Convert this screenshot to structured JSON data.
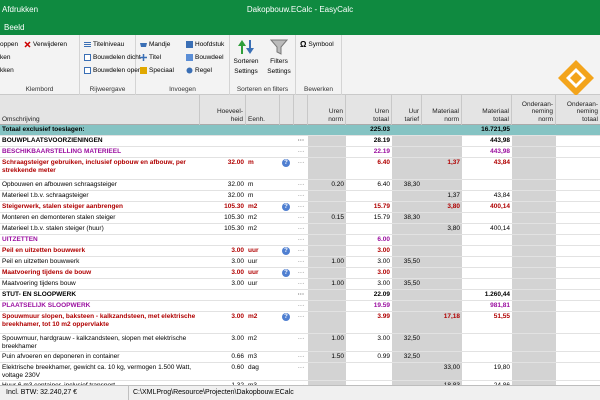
{
  "titlebar": {
    "left_menu": "Afdrukken",
    "title": "Dakopbouw.ECalc  -  EasyCalc"
  },
  "menubar": {
    "item": "Beeld"
  },
  "ribbon": {
    "klembord": {
      "label": "Klembord",
      "buttons": [
        "oppen",
        "Verwijderen",
        "ken",
        "kken"
      ]
    },
    "rijweergave": {
      "label": "Rijweergave",
      "buttons": [
        "Titelniveau",
        "Bouwdelen dicht",
        "Bouwdelen open"
      ]
    },
    "invoegen": {
      "label": "Invoegen",
      "buttons": [
        "Mandje",
        "Hoofdstuk",
        "Titel",
        "Bouwdeel",
        "Speciaal",
        "Regel"
      ]
    },
    "sorteren": {
      "label": "Sorteren en filters",
      "sort_label": "Sorteren",
      "sort_label2": "Settings",
      "filter_label": "Filters",
      "filter_label2": "Settings"
    },
    "bewerken": {
      "label": "Bewerken",
      "symbool": "Symbool"
    }
  },
  "columns": {
    "desc": "Omschrijving",
    "qty": "Hoeveel-\nheid",
    "unit": "Eenh.",
    "uren_norm": "Uren\nnorm",
    "uren_totaal": "Uren\ntotaal",
    "uur_tarief": "Uur\ntarief",
    "mat_norm": "Materiaal\nnorm",
    "mat_totaal": "Materiaal\ntotaal",
    "ond_norm": "Onderaan-\nneming\nnorm",
    "ond_totaal": "Onderaan-\nneming\ntotaal"
  },
  "rows": [
    {
      "type": "total",
      "desc": "Totaal exclusief toeslagen:",
      "ut": "225.03",
      "mt": "16.721,95"
    },
    {
      "type": "section",
      "desc": "BOUWPLAATSVOORZIENINGEN",
      "ut": "28.19",
      "mt": "443,98"
    },
    {
      "type": "sub",
      "desc": "BESCHIKBAARSTELLING MATERIEEL",
      "ut": "22.19",
      "mt": "443,98"
    },
    {
      "type": "item",
      "h": 22,
      "desc": "Schraagsteiger gebruiken, inclusief opbouw en afbouw, per strekkende meter",
      "qty": "32.00",
      "unit": "m",
      "info": true,
      "ut": "6.40",
      "mn": "1,37",
      "mt": "43,84"
    },
    {
      "type": "plain",
      "desc": "Opbouwen en afbouwen schraagsteiger",
      "qty": "32.00",
      "unit": "m",
      "un": "0.20",
      "ut": "6.40",
      "ur": "38,30"
    },
    {
      "type": "plain",
      "desc": "Materieel t.b.v. schraagsteiger",
      "qty": "32.00",
      "unit": "m",
      "mn": "1,37",
      "mt": "43,84"
    },
    {
      "type": "item",
      "desc": "Steigerwerk, stalen steiger aanbrengen",
      "qty": "105.30",
      "unit": "m2",
      "info": true,
      "ut": "15.79",
      "mn": "3,80",
      "mt": "400,14"
    },
    {
      "type": "plain",
      "desc": "Monteren en demonteren stalen steiger",
      "qty": "105.30",
      "unit": "m2",
      "un": "0.15",
      "ut": "15.79",
      "ur": "38,30"
    },
    {
      "type": "plain",
      "desc": "Materieel t.b.v. stalen steiger (huur)",
      "qty": "105.30",
      "unit": "m2",
      "mn": "3,80",
      "mt": "400,14"
    },
    {
      "type": "sub",
      "desc": "UITZETTEN",
      "ut": "6.00"
    },
    {
      "type": "item",
      "desc": "Peil en uitzetten bouwwerk",
      "qty": "3.00",
      "unit": "uur",
      "info": true,
      "ut": "3.00"
    },
    {
      "type": "plain",
      "desc": "Peil en uitzetten bouwwerk",
      "qty": "3.00",
      "unit": "uur",
      "un": "1.00",
      "ut": "3.00",
      "ur": "35,50"
    },
    {
      "type": "item",
      "desc": "Maatvoering tijdens de bouw",
      "qty": "3.00",
      "unit": "uur",
      "info": true,
      "ut": "3.00"
    },
    {
      "type": "plain",
      "desc": "Maatvoering tijdens bouw",
      "qty": "3.00",
      "unit": "uur",
      "un": "1.00",
      "ut": "3.00",
      "ur": "35,50"
    },
    {
      "type": "section",
      "desc": "STUT- EN SLOOPWERK",
      "ut": "22.09",
      "mt": "1.260,44"
    },
    {
      "type": "sub",
      "desc": "PLAATSELIJK SLOOPWERK",
      "ut": "19.59",
      "mt": "981,81"
    },
    {
      "type": "item",
      "h": 22,
      "desc": "Spouwmuur slopen, baksteen - kalkzandsteen, met elektrische breekhamer, tot 10 m2 oppervlakte",
      "qty": "3.00",
      "unit": "m2",
      "info": true,
      "ut": "3.99",
      "mn": "17,18",
      "mt": "51,55"
    },
    {
      "type": "plain",
      "h": 18,
      "desc": "Spouwmuur, hardgrauw - kalkzandsteen, slopen met elektrische breekhamer",
      "qty": "3.00",
      "unit": "m2",
      "un": "1.00",
      "ut": "3.00",
      "ur": "32,50"
    },
    {
      "type": "plain",
      "desc": "Puin afvoeren en deponeren in container",
      "qty": "0.66",
      "unit": "m3",
      "un": "1.50",
      "ut": "0.99",
      "ur": "32,50"
    },
    {
      "type": "plain",
      "h": 18,
      "desc": "Elektrische breekhamer, gewicht ca. 10 kg, vermogen 1.500 Watt, voltage 230V",
      "qty": "0.60",
      "unit": "dag",
      "mn": "33,00",
      "mt": "19,80"
    },
    {
      "type": "plain",
      "desc": "Huur 6 m3 container, inclusief transport",
      "qty": "1.32",
      "unit": "m3",
      "mn": "18,83",
      "mt": "24,86"
    },
    {
      "type": "plain",
      "desc": "",
      "qty": "",
      "unit": "",
      "mn": "6,50",
      "mt": "6,89"
    }
  ],
  "status": {
    "incl_btw": "Incl. BTW:  32.240,27 €",
    "path": "C:\\XMLProg\\Resource\\Projecten\\Dakopbouw.ECalc"
  }
}
